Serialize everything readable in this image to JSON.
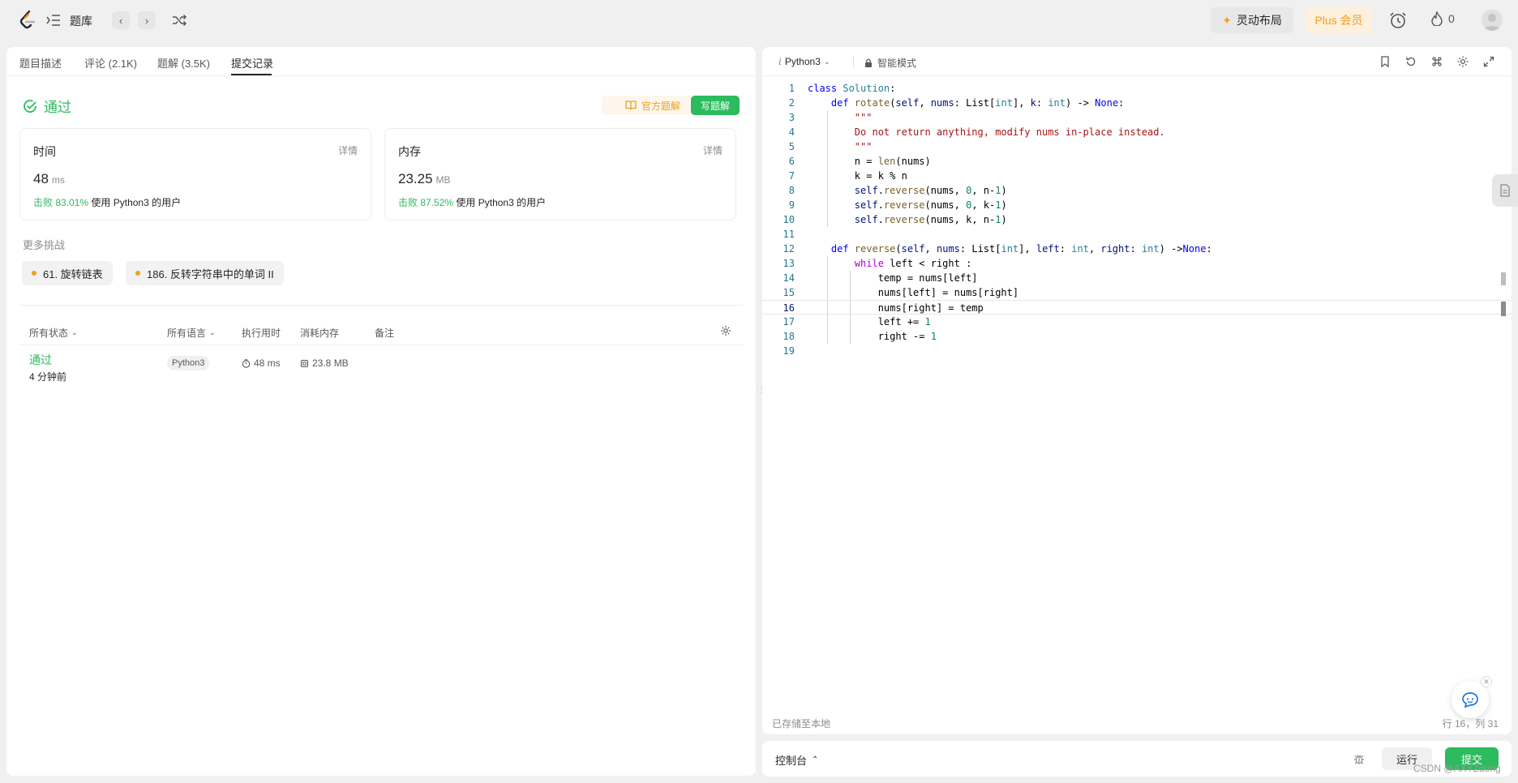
{
  "topbar": {
    "problem_bank": "题库",
    "layout_button": "灵动布局",
    "plus_button": "Plus 会员",
    "streak_count": "0"
  },
  "tabs": [
    "题目描述",
    "评论 (2.1K)",
    "题解 (3.5K)",
    "提交记录"
  ],
  "active_tab_index": 3,
  "result": {
    "status": "通过",
    "official_solution": "官方题解",
    "write_solution": "写题解"
  },
  "runtime": {
    "title": "时间",
    "detail": "详情",
    "value": "48",
    "unit": "ms",
    "beat_pct": "击败 83.01%",
    "beat_text": "使用 Python3 的用户"
  },
  "memory": {
    "title": "内存",
    "detail": "详情",
    "value": "23.25",
    "unit": "MB",
    "beat_pct": "击败 87.52%",
    "beat_text": "使用 Python3 的用户"
  },
  "more_challenges": {
    "title": "更多挑战",
    "items": [
      "61. 旋转链表",
      "186. 反转字符串中的单词 II"
    ]
  },
  "submissions": {
    "headers": {
      "status": "所有状态",
      "language": "所有语言",
      "runtime": "执行用时",
      "memory": "消耗内存",
      "notes": "备注"
    },
    "rows": [
      {
        "status": "通过",
        "time_ago": "4 分钟前",
        "language": "Python3",
        "runtime": "48 ms",
        "memory": "23.8 MB"
      }
    ]
  },
  "editor": {
    "language": "Python3",
    "mode": "智能模式",
    "saved_status": "已存储至本地",
    "cursor_position": "行 16，列 31",
    "current_line": 16
  },
  "console": {
    "label": "控制台",
    "run_button": "运行",
    "submit_button": "提交"
  },
  "watermark": "CSDN @AXYZdong",
  "colors": {
    "accent_green": "#2cbb5d",
    "accent_orange": "#f0a020"
  }
}
